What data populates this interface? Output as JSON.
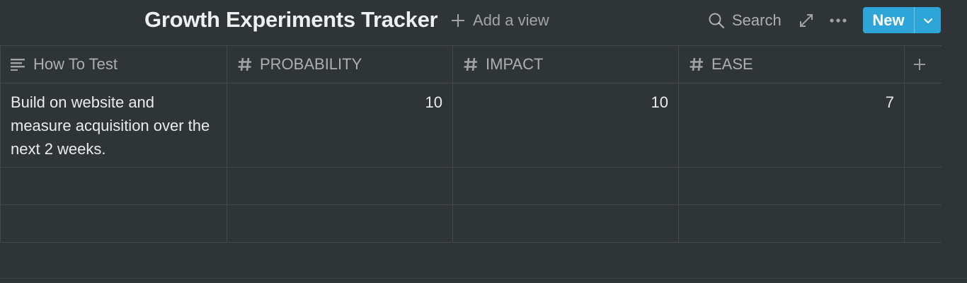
{
  "header": {
    "title": "Growth Experiments Tracker",
    "add_view_label": "Add a view",
    "search_label": "Search",
    "new_label": "New"
  },
  "table": {
    "columns": [
      {
        "label": "How To Test",
        "type": "text",
        "icon": "text-lines-icon"
      },
      {
        "label": "PROBABILITY",
        "type": "number",
        "icon": "hash-icon"
      },
      {
        "label": "IMPACT",
        "type": "number",
        "icon": "hash-icon"
      },
      {
        "label": "EASE",
        "type": "number",
        "icon": "hash-icon"
      }
    ],
    "rows": [
      {
        "how_to_test": "Build on website and measure acquisition over the next 2 weeks.",
        "probability": "10",
        "impact": "10",
        "ease": "7"
      }
    ]
  },
  "colors": {
    "background": "#2f3437",
    "accent": "#2ea5d8"
  }
}
